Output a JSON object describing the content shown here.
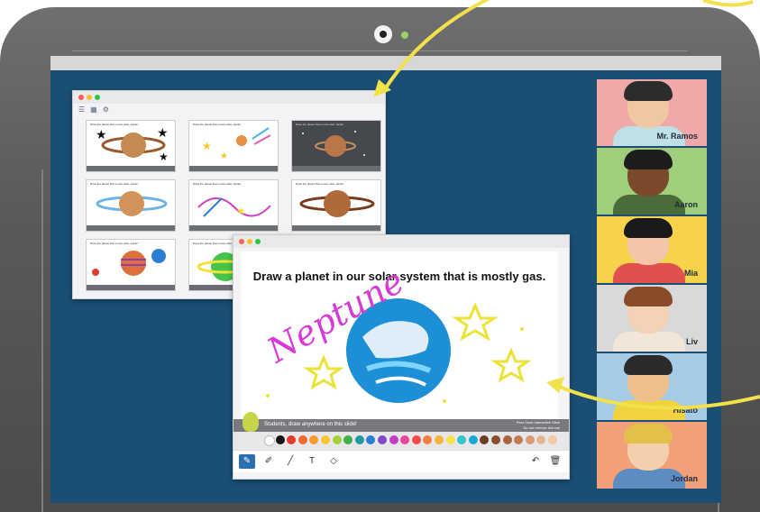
{
  "colors": {
    "screen": "#1a4f73",
    "bezel": "#5f5f5f",
    "arrow": "#f2e14a",
    "accent": "#2a6fb0"
  },
  "thumbnail_window": {
    "toolbar_icons": [
      "list-view-icon",
      "grid-view-icon",
      "settings-icon"
    ],
    "slides": [
      {
        "caption": "Draw the planet that comes after Jupiter"
      },
      {
        "caption": "Draw the planet that comes after Jupiter"
      },
      {
        "caption": "Draw the planet that comes after Jupiter"
      },
      {
        "caption": "Draw the planet that comes after Jupiter"
      },
      {
        "caption": "Draw the planet that comes after Jupiter"
      },
      {
        "caption": "Draw the planet that comes after Jupiter"
      },
      {
        "caption": "Draw the planet that comes after Jupiter"
      },
      {
        "caption": "Draw the planet that comes after Jupiter"
      }
    ]
  },
  "slide_window": {
    "prompt": "Draw a planet in our solar system that is mostly gas.",
    "drawing_text": "Neptune",
    "instruction": "Students, draw anywhere on this slide!",
    "brand_line1": "Pear Deck Interactive Slide",
    "brand_line2": "Do not remove this bar",
    "palette": [
      "#ffffff",
      "#111111",
      "#e23b2e",
      "#f0682b",
      "#f59b2a",
      "#f7c531",
      "#a6cf3a",
      "#41b24b",
      "#1f9a9e",
      "#2d7ed1",
      "#7b4cc2",
      "#c23ec4",
      "#e8469c",
      "#f54848",
      "#f17f3f",
      "#f6b23a",
      "#f7e44a",
      "#34c6c9",
      "#19a7d6",
      "#6a3c26",
      "#8a4e2c",
      "#a9653d",
      "#c17c52",
      "#d99a74",
      "#e9b48d",
      "#f2c7a5"
    ],
    "tools": [
      "pen-icon",
      "highlighter-icon",
      "line-icon",
      "text-icon",
      "eraser-icon",
      "undo-icon",
      "trash-icon"
    ]
  },
  "participants": [
    {
      "name": "Mr. Ramos",
      "bg": "#f1a8a8"
    },
    {
      "name": "Aaron",
      "bg": "#9fcf7c"
    },
    {
      "name": "Mia",
      "bg": "#f6d34b"
    },
    {
      "name": "Liv",
      "bg": "#d9d9d9"
    },
    {
      "name": "Hisato",
      "bg": "#a6cbe7"
    },
    {
      "name": "Jordan",
      "bg": "#f2a07a"
    }
  ]
}
